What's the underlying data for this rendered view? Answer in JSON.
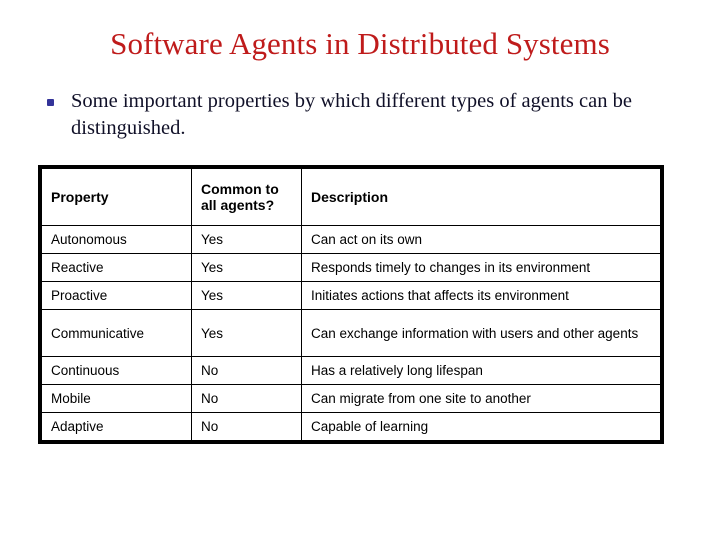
{
  "slide": {
    "title": "Software Agents in Distributed Systems",
    "title_color": "#bf1b1b",
    "background_color": "#ffffff",
    "bullets": [
      {
        "marker": "square-bullet",
        "marker_color": "#333399",
        "text": "Some important properties by which different types of agents can be distinguished."
      }
    ]
  },
  "table": {
    "border_color": "#000000",
    "headers": {
      "property": "Property",
      "common_line1": "Common to",
      "common_line2": "all agents?",
      "description": "Description"
    },
    "rows": [
      {
        "property": "Autonomous",
        "common": "Yes",
        "description": "Can act on its own"
      },
      {
        "property": "Reactive",
        "common": "Yes",
        "description": "Responds timely to changes in its environment"
      },
      {
        "property": "Proactive",
        "common": "Yes",
        "description": "Initiates actions that affects its environment"
      },
      {
        "property": "Communicative",
        "common": "Yes",
        "description": "Can exchange information with users and other agents"
      },
      {
        "property": "Continuous",
        "common": "No",
        "description": "Has a relatively long lifespan"
      },
      {
        "property": "Mobile",
        "common": "No",
        "description": "Can migrate from one site to another"
      },
      {
        "property": "Adaptive",
        "common": "No",
        "description": "Capable of learning"
      }
    ]
  }
}
